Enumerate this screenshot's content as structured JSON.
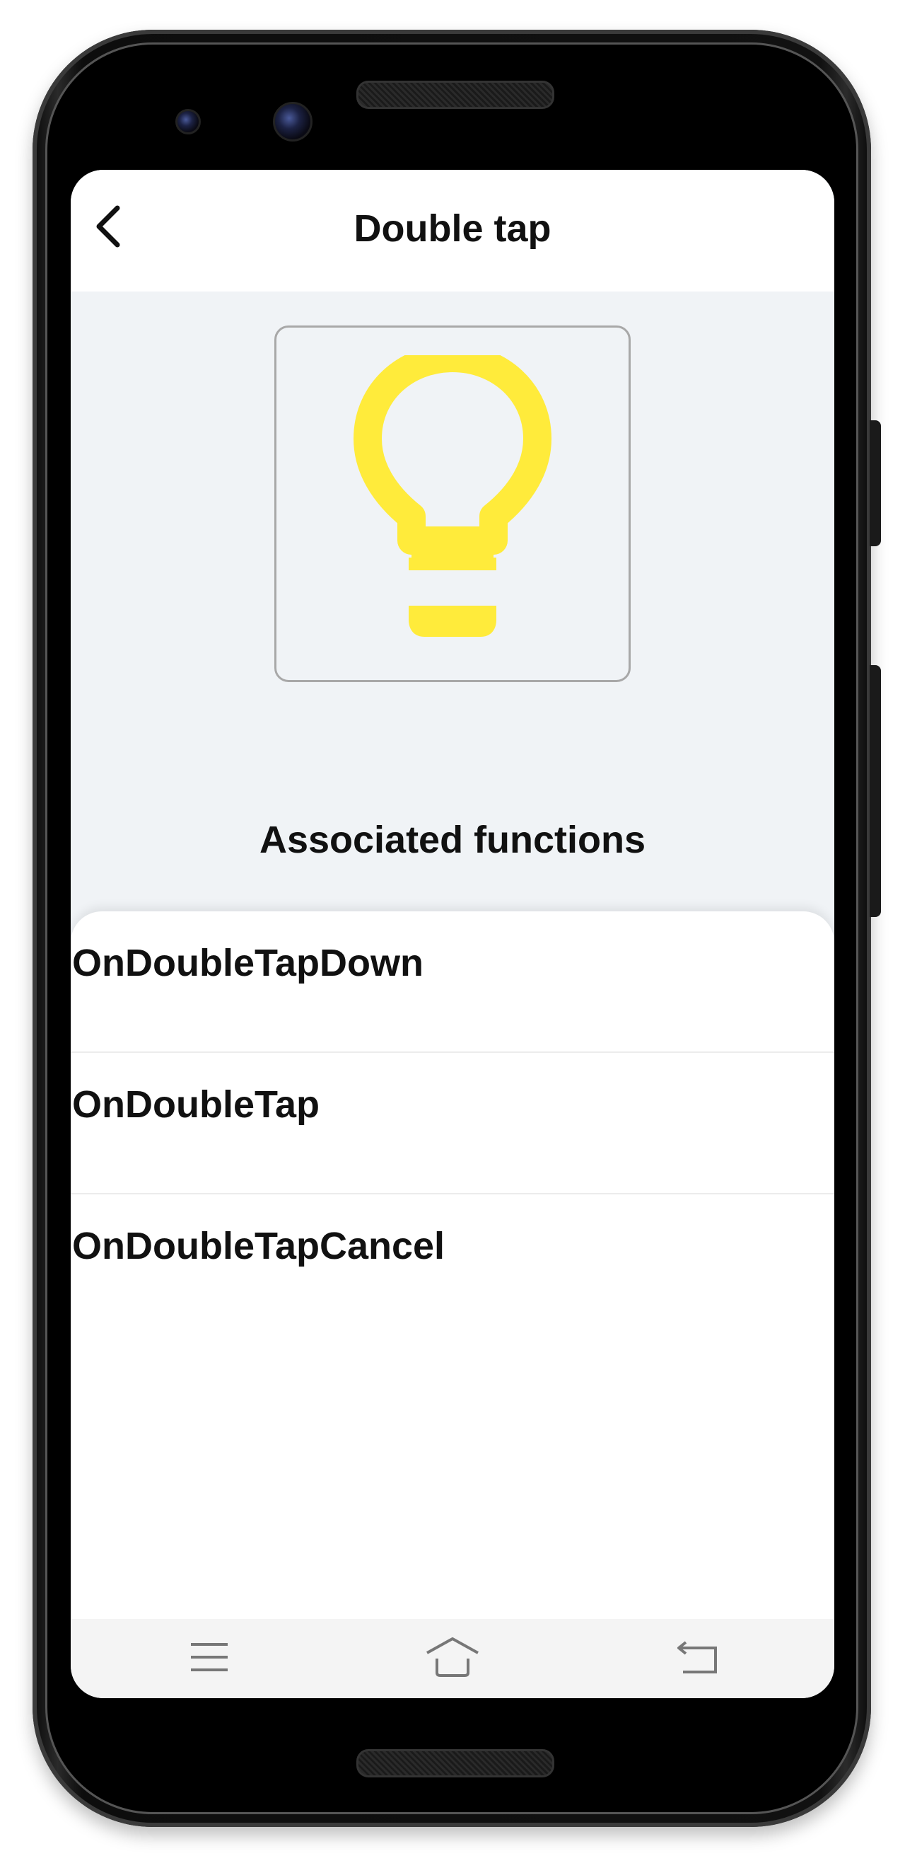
{
  "app_bar": {
    "title": "Double tap",
    "back_icon": "chevron-left-icon"
  },
  "hero": {
    "icon": "lightbulb-icon",
    "icon_color": "#ffeb3b"
  },
  "section": {
    "heading": "Associated functions"
  },
  "functions": [
    {
      "label": "OnDoubleTapDown"
    },
    {
      "label": "OnDoubleTap"
    },
    {
      "label": "OnDoubleTapCancel"
    }
  ],
  "system_nav": {
    "menu_icon": "menu-icon",
    "home_icon": "home-icon",
    "back_icon": "back-arrow-icon"
  },
  "colors": {
    "screen_background": "#f0f3f6",
    "surface": "#ffffff",
    "text": "#111111"
  }
}
